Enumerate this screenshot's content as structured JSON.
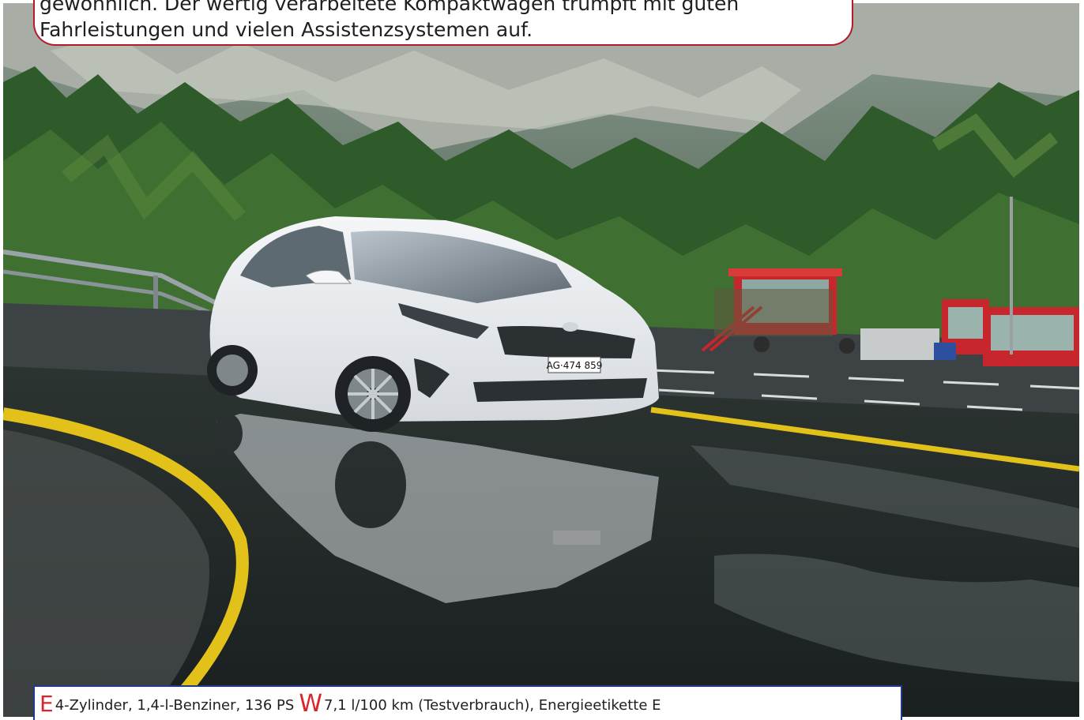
{
  "caption": {
    "line1": "gewöhnlich. Der wertig verarbeitete Kompaktwagen trumpft mit guten",
    "line2": "Fahrleistungen und vielen Assistenzsystemen auf."
  },
  "photo": {
    "license_plate": "AG·474 859"
  },
  "specs": {
    "engine_letter": "E",
    "engine_text": "4-Zylinder, 1,4-l-Benziner, 136 PS",
    "consumption_letter": "W",
    "consumption_text": "7,1 l/100 km (Testverbrauch), Energieetikette E"
  },
  "colors": {
    "caption_border": "#b31b2b",
    "spec_border": "#1f3a8a",
    "spec_letter": "#d9252b"
  }
}
